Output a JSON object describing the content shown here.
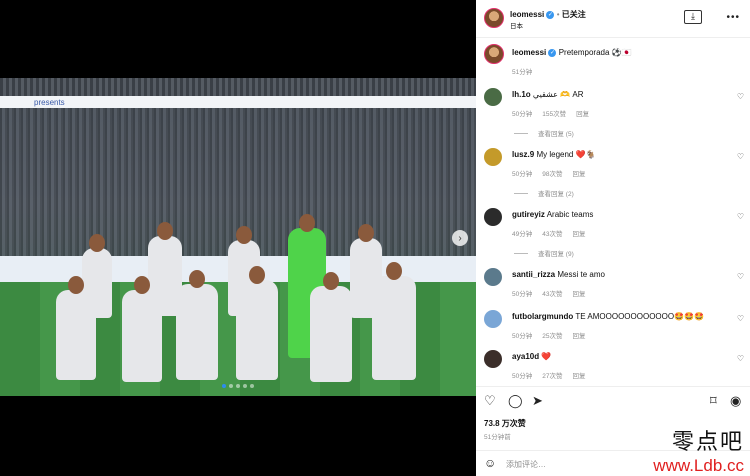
{
  "post": {
    "author": "leomessi",
    "follow_label": "已关注",
    "location": "日本",
    "caption": "Pretemporada ⚽🇯🇵",
    "caption_time": "51分钟",
    "likes": "73.8 万次赞",
    "post_time": "51分钟前",
    "add_comment_placeholder": "添加评论…",
    "banner_text": "presents"
  },
  "comments": [
    {
      "user": "lh.1o",
      "text": "عشقيي 🫶 AR",
      "time": "50分钟",
      "likes": "155次赞",
      "reply": "回复",
      "view_replies": "查看回复 (5)",
      "avatar_color": "#4a6b45"
    },
    {
      "user": "lusz.9",
      "text": "My legend ❤️🐐",
      "time": "50分钟",
      "likes": "98次赞",
      "reply": "回复",
      "view_replies": "查看回复 (2)",
      "avatar_color": "#c49a2a"
    },
    {
      "user": "gutireyiz",
      "text": "Arabic teams",
      "time": "49分钟",
      "likes": "43次赞",
      "reply": "回复",
      "view_replies": "查看回复 (9)",
      "avatar_color": "#2b2b2b"
    },
    {
      "user": "santii_rizza",
      "text": "Messi te amo",
      "time": "50分钟",
      "likes": "43次赞",
      "reply": "回复",
      "view_replies": "",
      "avatar_color": "#5b7a8c"
    },
    {
      "user": "futbolargmundo",
      "text": "TE AMOOOOOOOOOOOO🤩🤩🤩",
      "time": "50分钟",
      "likes": "25次赞",
      "reply": "回复",
      "view_replies": "",
      "avatar_color": "#7aa6d6"
    },
    {
      "user": "aya10d",
      "text": "❤️",
      "time": "50分钟",
      "likes": "27次赞",
      "reply": "回复",
      "view_replies": "",
      "avatar_color": "#3b2e2a"
    }
  ],
  "watermark": {
    "line1": "零点吧",
    "line2": "www.Ldb.cc"
  }
}
